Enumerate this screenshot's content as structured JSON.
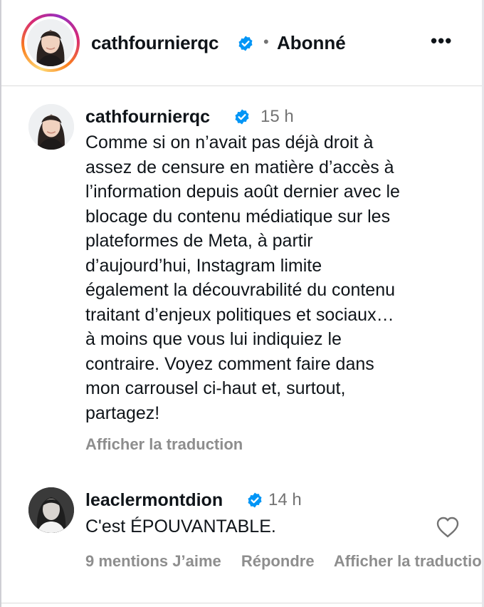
{
  "post_header": {
    "username": "cathfournierqc",
    "separator": "•",
    "follow_status": "Abonné",
    "more_label": "•••"
  },
  "caption": {
    "username": "cathfournierqc",
    "time": "15 h",
    "text": "Comme si on n’avait pas déjà droit à\nassez de censure en matière d’accès à\nl’information depuis août dernier avec le\nblocage du contenu médiatique sur les\nplateformes de Meta, à partir\nd’aujourd’hui, Instagram limite\négalement la découvrabilité du contenu\ntraitant d’enjeux politiques et sociaux…\nà moins que vous lui indiquiez le\ncontraire. Voyez comment faire dans\nmon carrousel ci-haut et, surtout,\npartagez!",
    "translate_label": "Afficher la traduction"
  },
  "comment": {
    "username": "leaclermontdion",
    "time": "14 h",
    "text": "C'est ÉPOUVANTABLE.",
    "likes_label": "9 mentions J’aime",
    "reply_label": "Répondre",
    "translate_label": "Afficher la traduction"
  },
  "icons": {
    "verified": "verified-badge-icon",
    "heart": "heart-outline-icon",
    "more": "more-horizontal-icon"
  },
  "colors": {
    "verified_blue": "#0095f6",
    "secondary_text": "#737373",
    "action_text": "#8e8e8e"
  }
}
